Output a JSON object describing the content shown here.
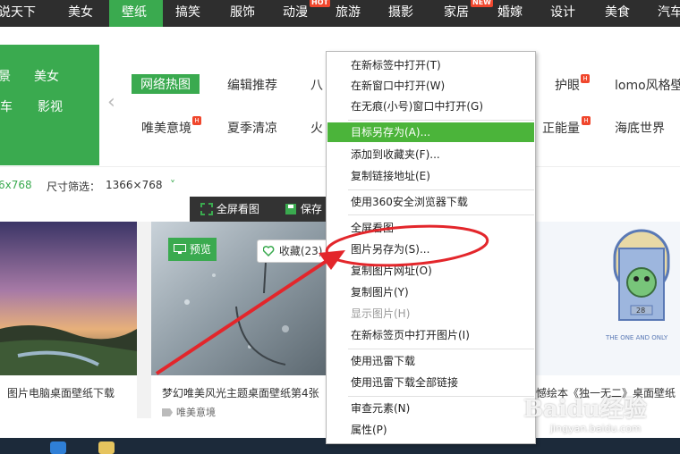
{
  "nav": {
    "items": [
      {
        "label": "说天下"
      },
      {
        "label": "美女"
      },
      {
        "label": "壁纸"
      },
      {
        "label": "搞笑"
      },
      {
        "label": "服饰"
      },
      {
        "label": "动漫",
        "badge": "HOT"
      },
      {
        "label": "旅游"
      },
      {
        "label": "摄影"
      },
      {
        "label": "家居",
        "badge": "NEW"
      },
      {
        "label": "婚嫁"
      },
      {
        "label": "设计"
      },
      {
        "label": "美食"
      },
      {
        "label": "汽车"
      }
    ],
    "active_index": 2
  },
  "side": {
    "items": [
      "景",
      "美女",
      "车",
      "影视"
    ]
  },
  "categories": {
    "row1": [
      "网络热图",
      "编辑推荐",
      "八",
      "护眼",
      "lomo风格壁"
    ],
    "row2": [
      "唯美意境",
      "夏季清凉",
      "火",
      "正能量",
      "海底世界"
    ],
    "hot_badge": "H"
  },
  "filter": {
    "left_res": "6x768",
    "size_label": "尺寸筛选：",
    "size_value": "1366×768",
    "chevron": "˅"
  },
  "toolbar": {
    "fullscreen": "全屏看图",
    "save": "保存"
  },
  "cards": [
    {
      "caption": "图片电脑桌面壁纸下载",
      "tag": ""
    },
    {
      "caption": "梦幻唯美风光主题桌面壁纸第4张",
      "tag": "唯美意境"
    },
    {
      "caption": "憾绘本《独一无二》桌面壁纸",
      "tag": ""
    }
  ],
  "overlay_buttons": {
    "preview": "预览",
    "favorite": "收藏(23)"
  },
  "art_text": "THE ONE AND ONLY",
  "art_number": "28",
  "context_menu": {
    "items": [
      {
        "label": "在新标签中打开(T)",
        "state": "normal"
      },
      {
        "label": "在新窗口中打开(W)",
        "state": "normal"
      },
      {
        "label": "在无痕(小号)窗口中打开(G)",
        "state": "normal"
      },
      {
        "label": "目标另存为(A)...",
        "state": "highlighted"
      },
      {
        "label": "添加到收藏夹(F)...",
        "state": "normal"
      },
      {
        "label": "复制链接地址(E)",
        "state": "normal"
      },
      {
        "label": "使用360安全浏览器下载",
        "state": "normal"
      },
      {
        "label": "全屏看图",
        "state": "normal"
      },
      {
        "label": "图片另存为(S)...",
        "state": "normal"
      },
      {
        "label": "复制图片网址(O)",
        "state": "normal"
      },
      {
        "label": "复制图片(Y)",
        "state": "normal"
      },
      {
        "label": "显示图片(H)",
        "state": "disabled"
      },
      {
        "label": "在新标签页中打开图片(I)",
        "state": "normal"
      },
      {
        "label": "使用迅雷下载",
        "state": "normal"
      },
      {
        "label": "使用迅雷下载全部链接",
        "state": "normal"
      },
      {
        "label": "审查元素(N)",
        "state": "normal"
      },
      {
        "label": "属性(P)",
        "state": "normal"
      }
    ]
  },
  "watermark": {
    "main": "Baidu经验",
    "sub": "jingyan.baidu.com"
  },
  "colors": {
    "brand_green": "#3aaa4f",
    "menu_highlight": "#4bb43a",
    "nav_bg": "#2e2e2e",
    "badge_red": "#f0472d",
    "annotation_red": "#e3262b"
  }
}
